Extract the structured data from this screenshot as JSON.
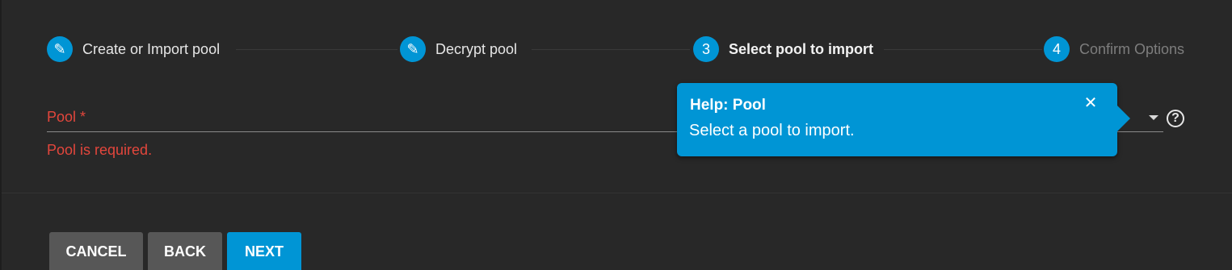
{
  "stepper": {
    "steps": [
      {
        "badge": "✎",
        "label": "Create or Import pool",
        "state": "completed"
      },
      {
        "badge": "✎",
        "label": "Decrypt pool",
        "state": "completed"
      },
      {
        "badge": "3",
        "label": "Select pool to import",
        "state": "active"
      },
      {
        "badge": "4",
        "label": "Confirm Options",
        "state": "inactive"
      }
    ]
  },
  "form": {
    "pool_label": "Pool *",
    "pool_error": "Pool is required.",
    "help_icon": "?"
  },
  "tooltip": {
    "title": "Help: Pool",
    "body": "Select a pool to import.",
    "close": "✕"
  },
  "actions": {
    "cancel": "CANCEL",
    "back": "BACK",
    "next": "NEXT"
  },
  "colors": {
    "accent": "#0095d5",
    "error": "#e3463c",
    "background": "#282828"
  }
}
